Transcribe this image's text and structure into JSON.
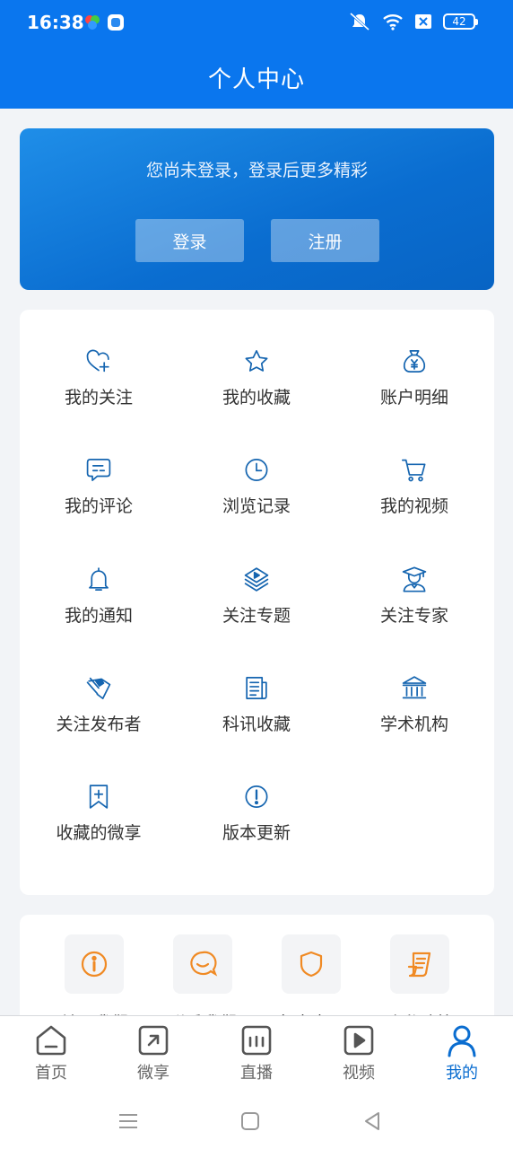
{
  "status": {
    "time": "16:38",
    "battery": "42"
  },
  "header": {
    "title": "个人中心"
  },
  "login": {
    "tip": "您尚未登录，登录后更多精彩",
    "login_label": "登录",
    "register_label": "注册"
  },
  "grid": {
    "items": [
      {
        "label": "我的关注",
        "icon": "heart-plus-icon"
      },
      {
        "label": "我的收藏",
        "icon": "star-icon"
      },
      {
        "label": "账户明细",
        "icon": "money-bag-icon"
      },
      {
        "label": "我的评论",
        "icon": "comment-icon"
      },
      {
        "label": "浏览记录",
        "icon": "clock-icon"
      },
      {
        "label": "我的视频",
        "icon": "cart-icon"
      },
      {
        "label": "我的通知",
        "icon": "bell-icon"
      },
      {
        "label": "关注专题",
        "icon": "topic-icon"
      },
      {
        "label": "关注专家",
        "icon": "expert-icon"
      },
      {
        "label": "关注发布者",
        "icon": "publisher-icon"
      },
      {
        "label": "科讯收藏",
        "icon": "news-icon"
      },
      {
        "label": "学术机构",
        "icon": "institution-icon"
      },
      {
        "label": "收藏的微享",
        "icon": "bookmark-plus-icon"
      },
      {
        "label": "版本更新",
        "icon": "exclamation-icon"
      }
    ]
  },
  "about": {
    "items": [
      {
        "label": "关于我们",
        "icon": "info-icon"
      },
      {
        "label": "联系我们",
        "icon": "chat-icon"
      },
      {
        "label": "免责声明",
        "icon": "shield-icon"
      },
      {
        "label": "隐私政策",
        "icon": "document-icon"
      }
    ]
  },
  "tabs": [
    {
      "label": "首页",
      "icon": "home-icon"
    },
    {
      "label": "微享",
      "icon": "share-icon"
    },
    {
      "label": "直播",
      "icon": "live-icon"
    },
    {
      "label": "视频",
      "icon": "video-icon"
    },
    {
      "label": "我的",
      "icon": "user-icon",
      "active": true
    }
  ],
  "colors": {
    "primary": "#0a76ee",
    "icon_blue": "#1565b0",
    "orange": "#f08a24"
  }
}
